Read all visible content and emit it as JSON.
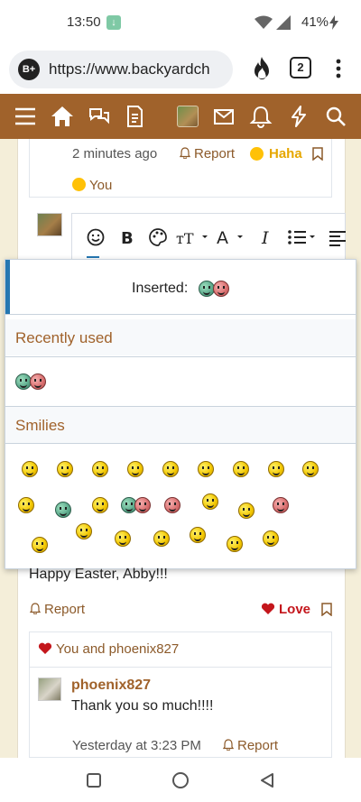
{
  "status": {
    "time": "13:50",
    "battery": "41%"
  },
  "browser": {
    "url": "https://www.backyardch",
    "badge": "B+",
    "tabs": "2"
  },
  "comment": {
    "time": "2 minutes ago",
    "report": "Report",
    "reaction": "Haha",
    "reacted_by": "You"
  },
  "popup": {
    "inserted_label": "Inserted:",
    "recent_title": "Recently used",
    "smilies_title": "Smilies"
  },
  "post": {
    "text": "Happy Easter, Abby!!!",
    "report": "Report",
    "reaction": "Love",
    "reacted_by": "You and phoenix827"
  },
  "reply": {
    "user": "phoenix827",
    "text": "Thank you so much!!!!",
    "time": "Yesterday at 3:23 PM",
    "report": "Report"
  },
  "colors": {
    "brand": "#a0622b",
    "accent": "#2577b1",
    "love": "#c4161c",
    "haha": "#e6a700",
    "page_bg": "#f4eed9"
  }
}
